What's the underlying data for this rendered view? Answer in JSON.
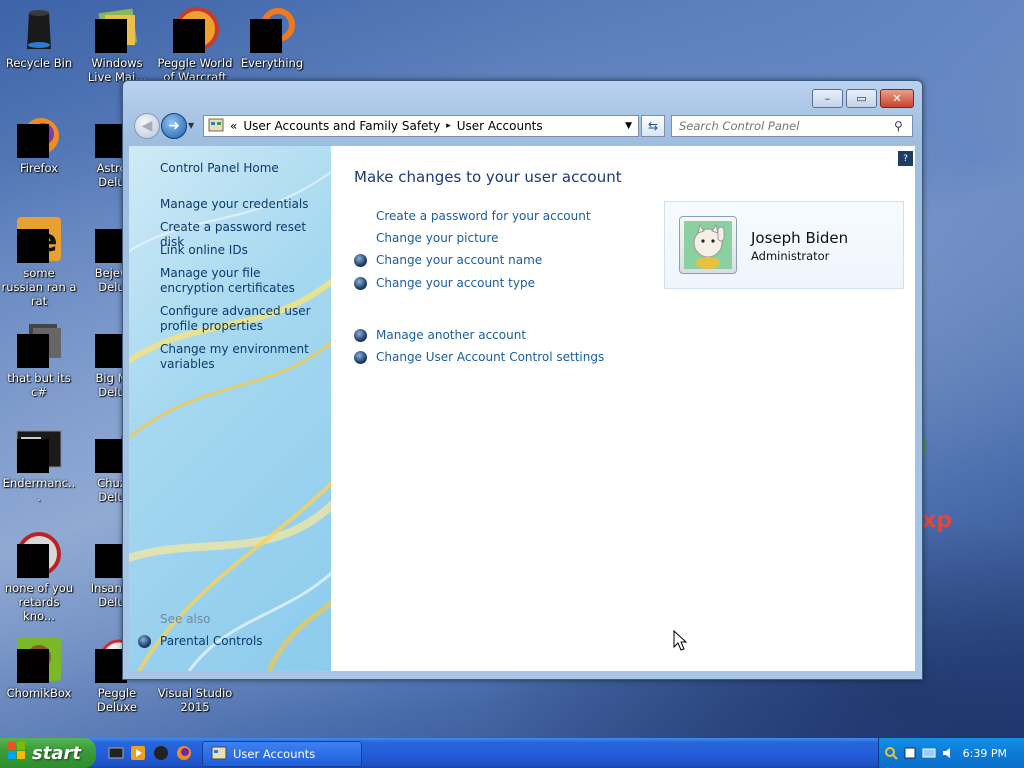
{
  "desktop": {
    "icons": [
      {
        "label": "Recycle Bin",
        "icon": "recycle-bin-icon"
      },
      {
        "label": "Windows Live Mai...",
        "icon": "windows-live-mail-icon"
      },
      {
        "label": "Peggle World of Warcraft",
        "icon": "peggle-world-icon"
      },
      {
        "label": "Everything",
        "icon": "everything-search-icon"
      },
      {
        "label": "Firefox",
        "icon": "firefox-icon"
      },
      {
        "label": "Astro... Delu...",
        "icon": "astropop-icon"
      },
      {
        "label": "some russian ran a rat",
        "icon": "game-icon"
      },
      {
        "label": "Bejew... Delu...",
        "icon": "bejeweled-icon"
      },
      {
        "label": "that but its c#",
        "icon": "shortcut-icon"
      },
      {
        "label": "Big M... Delu...",
        "icon": "big-money-icon"
      },
      {
        "label": "Endermanc...",
        "icon": "terminal-icon"
      },
      {
        "label": "Chuz... Delu...",
        "icon": "chuzzle-icon"
      },
      {
        "label": "none of you retards kno...",
        "icon": "orb-icon"
      },
      {
        "label": "Insaniq... Delu...",
        "icon": "insaniquarium-icon"
      },
      {
        "label": "ChomikBox",
        "icon": "chomikbox-icon"
      },
      {
        "label": "Peggle Deluxe",
        "icon": "peggle-icon"
      },
      {
        "label": "Visual Studio 2015",
        "icon": "visual-studio-icon"
      }
    ],
    "stray_text": "xp"
  },
  "window": {
    "caption_buttons": {
      "minimize": "–",
      "maximize": "▭",
      "close": "✕"
    },
    "breadcrumb": {
      "overflow": "«",
      "items": [
        "User Accounts and Family Safety",
        "User Accounts"
      ],
      "separator": "▸"
    },
    "search_placeholder": "Search Control Panel",
    "left_pane": {
      "home": "Control Panel Home",
      "links": [
        "Manage your credentials",
        "Create a password reset disk",
        "Link online IDs",
        "Manage your file encryption certificates",
        "Configure advanced user profile properties",
        "Change my environment variables"
      ],
      "see_also_label": "See also",
      "see_also_links": [
        "Parental Controls"
      ]
    },
    "content": {
      "title": "Make changes to your user account",
      "tasks": [
        "Create a password for your account",
        "Change your picture",
        "Change your account name",
        "Change your account type"
      ],
      "other_tasks": [
        "Manage another account",
        "Change User Account Control settings"
      ],
      "account": {
        "name": "Joseph Biden",
        "type": "Administrator",
        "picture": "lucky-cat-picture"
      }
    }
  },
  "taskbar": {
    "start_label": "start",
    "task_button": "User Accounts",
    "clock": "6:39 PM",
    "colors": {
      "taskbar": "#245edb",
      "start": "#3c9b3a",
      "tray": "#0d7bd6"
    }
  }
}
